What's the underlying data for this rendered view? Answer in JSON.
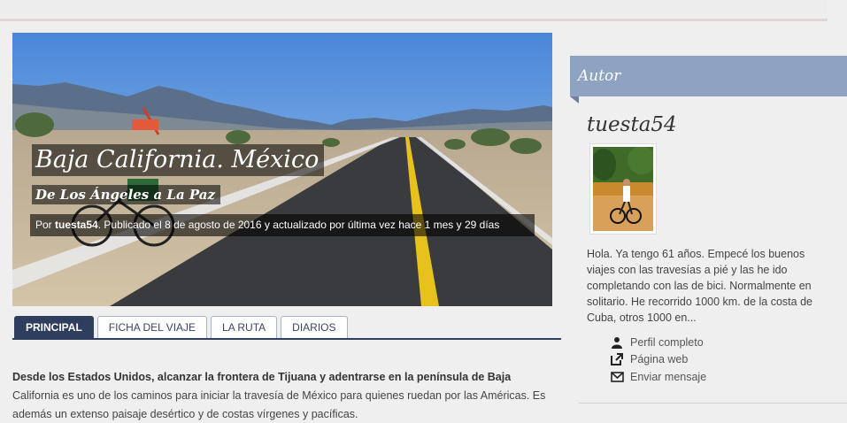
{
  "hero": {
    "title": "Baja California. México",
    "subtitle": "De Los Ángeles a La Paz",
    "meta_prefix": "Por ",
    "meta_author": "tuesta54",
    "meta_rest": ". Publicado el 8 de agosto de 2016 y actualizado por última vez hace 1 mes y 29 días"
  },
  "tabs": [
    {
      "label": "PRINCIPAL",
      "active": true
    },
    {
      "label": "FICHA DEL VIAJE"
    },
    {
      "label": "LA RUTA"
    },
    {
      "label": "DIARIOS"
    }
  ],
  "intro": {
    "bold": "Desde los Estados Unidos, alcanzar la frontera de Tijuana y adentrarse en la península de Baja",
    "rest": "California es uno de los caminos para iniciar la travesía de México para quienes ruedan por las Américas. Es además un extenso paisaje desértico y de costas vírgenes y pacíficas."
  },
  "sidebar": {
    "heading": "Autor",
    "author_name": "tuesta54",
    "bio": "Hola. Ya tengo 61 años. Empecé los buenos viajes con las travesías a pié y las he ido completando con las de bici. Normalmente en solitario. He recorrido 1000 km. de la costa de Cuba, otros 1000 en...",
    "links": [
      {
        "label": "Perfil completo",
        "icon": "user-icon"
      },
      {
        "label": "Página web",
        "icon": "external-link-icon"
      },
      {
        "label": "Enviar mensaje",
        "icon": "envelope-icon"
      }
    ]
  },
  "colors": {
    "accent_dark": "#2f3d5e",
    "sidebar_head": "#8ea2c2"
  }
}
